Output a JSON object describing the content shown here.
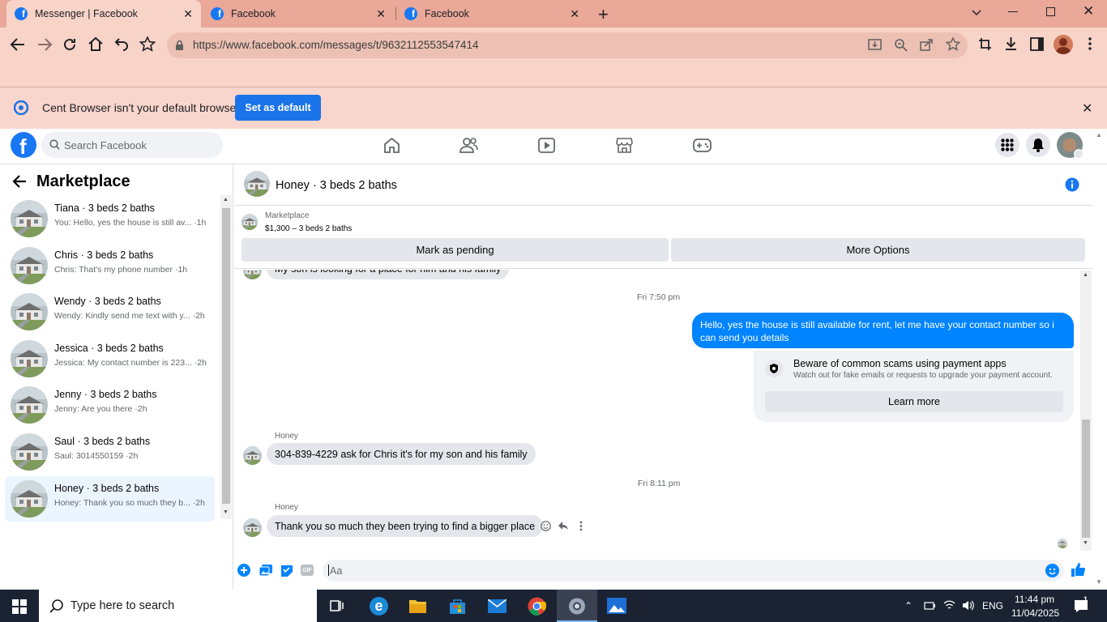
{
  "browser": {
    "tabs": [
      {
        "title": "Messenger | Facebook",
        "active": true
      },
      {
        "title": "Facebook",
        "active": false
      },
      {
        "title": "Facebook",
        "active": false
      }
    ],
    "url": "https://www.facebook.com/messages/t/9632112553547414",
    "infobar": {
      "message": "Cent Browser isn't your default browser",
      "button": "Set as default"
    }
  },
  "facebook": {
    "logo": "f",
    "search_placeholder": "Search Facebook"
  },
  "sidebar": {
    "title": "Marketplace",
    "conversations": [
      {
        "name": "Tiana · 3 beds 2 baths",
        "preview": "You: Hello, yes the house is still av... ·1h",
        "selected": false
      },
      {
        "name": "Chris · 3 beds 2 baths",
        "preview": "Chris: That's my phone number ·1h",
        "selected": false
      },
      {
        "name": "Wendy · 3 beds 2 baths",
        "preview": "Wendy: Kindly send me text with y... ·2h",
        "selected": false
      },
      {
        "name": "Jessica · 3 beds 2 baths",
        "preview": "Jessica: My contact number is 223... ·2h",
        "selected": false
      },
      {
        "name": "Jenny · 3 beds 2 baths",
        "preview": "Jenny: Are you there ·2h",
        "selected": false
      },
      {
        "name": "Saul · 3 beds 2 baths",
        "preview": "Saul: 3014550159 ·2h",
        "selected": false
      },
      {
        "name": "Honey · 3 beds 2 baths",
        "preview": "Honey: Thank you so much they b... ·2h",
        "selected": true
      }
    ]
  },
  "chat": {
    "title": "Honey · 3 beds 2 baths",
    "listing": {
      "source": "Marketplace",
      "detail": "$1,300 – 3 beds 2 baths"
    },
    "buttons": {
      "pending": "Mark as pending",
      "more": "More Options"
    },
    "messages": {
      "cut_off": "My son is looking for a place for him and his family",
      "time1": "Fri 7:50 pm",
      "outgoing": "Hello, yes the house is still available for rent, let me have your contact number so i can send you details",
      "scam_title": "Beware of common scams using payment apps",
      "scam_body": "Watch out for fake emails or requests to upgrade your payment account.",
      "learn_more": "Learn more",
      "sender1": "Honey",
      "incoming1": "304-839-4229 ask for Chris it's for my son and his family",
      "time2": "Fri 8:11 pm",
      "sender2": "Honey",
      "incoming2": "Thank you so much they been trying to find a bigger place"
    },
    "compose_placeholder": "Aa"
  },
  "taskbar": {
    "search_placeholder": "Type here to search",
    "language": "ENG",
    "time": "11:44 pm",
    "date": "11/04/2025",
    "notification_count": "1"
  },
  "colors": {
    "fb_blue": "#1877f2",
    "messenger_blue": "#0084ff",
    "chrome_tab": "#e9a898",
    "chrome_toolbar": "#f8d3c8"
  }
}
